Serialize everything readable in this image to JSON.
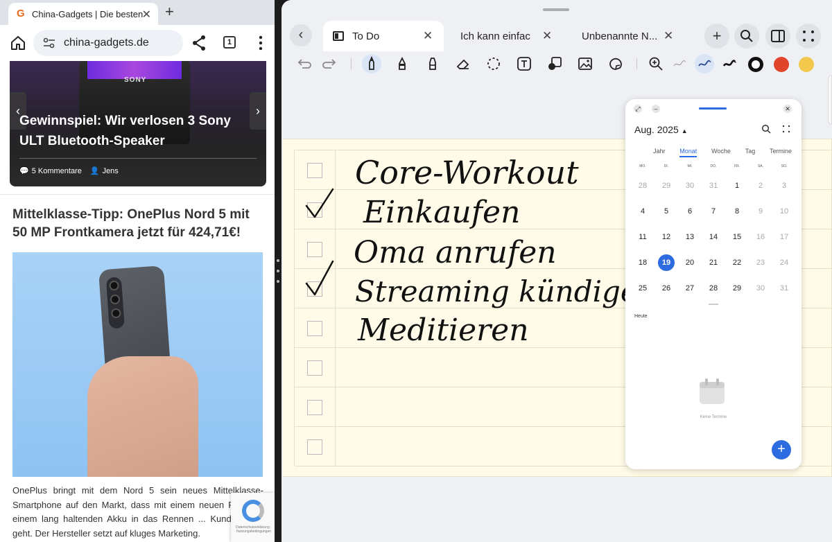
{
  "browser": {
    "tab_title": "China-Gadgets | Die besten",
    "favicon_letter": "G",
    "url": "china-gadgets.de",
    "tab_count": "1",
    "hero": {
      "title": "Gewinnspiel: Wir verlosen 3 Sony ULT Bluetooth-Speaker",
      "speaker_brand": "SONY",
      "comments": "5 Kommentare",
      "author": "Jens"
    },
    "article": {
      "title": "Mittelklasse-Tipp: OnePlus Nord 5 mit 50 MP Frontkamera jetzt für 424,71€!",
      "body": "OnePlus bringt mit dem Nord 5 sein neues Mittelklasse-Smartphone auf den Markt, dass mit einem neuen Pr... und einem lang haltenden Akku in das Rennen ... Kundengunst geht. Der Hersteller setzt auf kluges Marketing."
    },
    "recaptcha_text": "Datenschutzerklärung · Nutzungsbedingungen"
  },
  "notes": {
    "tabs": [
      {
        "label": "To Do"
      },
      {
        "label": "Ich kann einfac"
      },
      {
        "label": "Unbenannte N..."
      }
    ],
    "colors": {
      "black": "#111111",
      "red": "#e0452b",
      "yellow": "#f2c94c",
      "highlight": "#d9e4f7"
    },
    "todo_items": [
      {
        "text": "Core-Workout",
        "checked": false
      },
      {
        "text": "Einkaufen",
        "checked": true
      },
      {
        "text": "Oma anrufen",
        "checked": false
      },
      {
        "text": "Streaming kündigen",
        "checked": true
      },
      {
        "text": "Meditieren",
        "checked": false
      }
    ]
  },
  "calendar": {
    "month": "Aug. 2025",
    "views": [
      "Jahr",
      "Monat",
      "Woche",
      "Tag",
      "Termine"
    ],
    "active_view": "Monat",
    "dows": [
      "MO.",
      "DI.",
      "MI.",
      "DO.",
      "FR.",
      "SA.",
      "SO."
    ],
    "today_label": "Heute",
    "empty_text": "Keine Termine",
    "days": [
      "28",
      "29",
      "30",
      "31",
      "1",
      "2",
      "3",
      "4",
      "5",
      "6",
      "7",
      "8",
      "9",
      "10",
      "11",
      "12",
      "13",
      "14",
      "15",
      "16",
      "17",
      "18",
      "19",
      "20",
      "21",
      "22",
      "23",
      "24",
      "25",
      "26",
      "27",
      "28",
      "29",
      "30",
      "31"
    ],
    "selected_day": "19"
  }
}
